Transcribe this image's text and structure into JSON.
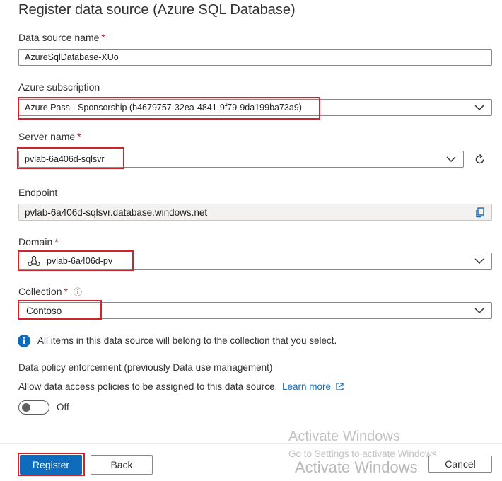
{
  "page": {
    "title": "Register data source (Azure SQL Database)"
  },
  "form": {
    "data_source_name": {
      "label": "Data source name",
      "required_mark": "*",
      "value": "AzureSqlDatabase-XUo"
    },
    "azure_subscription": {
      "label": "Azure subscription",
      "value": "Azure Pass - Sponsorship (b4679757-32ea-4841-9f79-9da199ba73a9)"
    },
    "server_name": {
      "label": "Server name",
      "required_mark": "*",
      "value": "pvlab-6a406d-sqlsvr"
    },
    "endpoint": {
      "label": "Endpoint",
      "value": "pvlab-6a406d-sqlsvr.database.windows.net"
    },
    "domain": {
      "label": "Domain",
      "required_mark": "*",
      "value": "pvlab-6a406d-pv"
    },
    "collection": {
      "label": "Collection",
      "required_mark": "*",
      "value": "Contoso",
      "info_icon": "ⓘ"
    }
  },
  "info_message": {
    "icon": "i",
    "text": "All items in this data source will belong to the collection that you select."
  },
  "policy": {
    "title": "Data policy enforcement (previously Data use management)",
    "description": "Allow data access policies to be assigned to this data source.",
    "learn_more": "Learn more",
    "toggle_state": "Off"
  },
  "footer": {
    "register": "Register",
    "back": "Back",
    "cancel": "Cancel"
  },
  "watermark": {
    "line1": "Activate Windows",
    "line2": "Go to Settings to activate Windows.",
    "line3": "Activate Windows"
  },
  "colors": {
    "accent": "#0f6cbd",
    "highlight_box": "#d1232a",
    "required": "#a4262c"
  }
}
